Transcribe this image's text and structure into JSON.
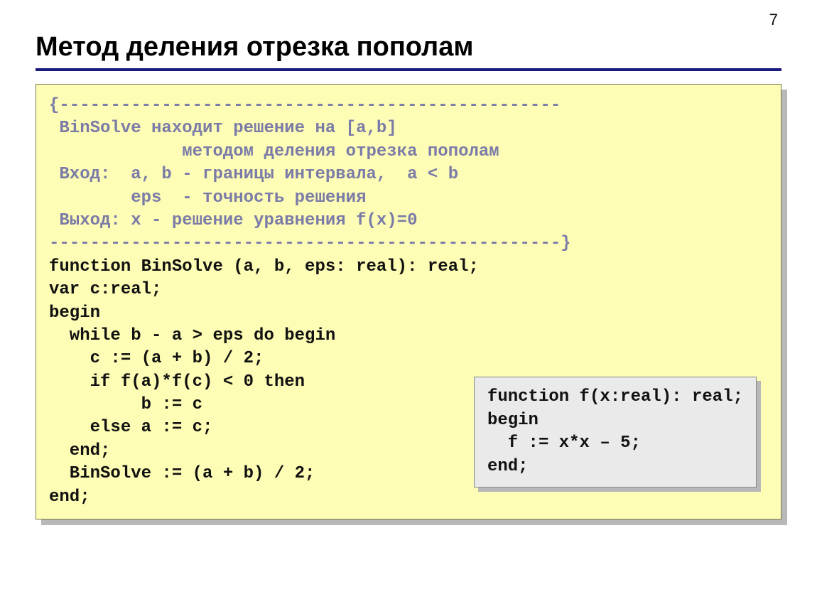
{
  "page_number": "7",
  "title": "Метод деления отрезка пополам",
  "code": {
    "c1": "{-------------------------------------------------",
    "c2": " BinSolve находит решение на [a,b]",
    "c3": "             методом деления отрезка пополам",
    "c4": " Вход:  a, b - границы интервала,  a < b",
    "c5": "        eps  - точность решения",
    "c6": " Выход: x - решение уравнения f(x)=0",
    "c7": "--------------------------------------------------}",
    "l1": "function BinSolve (a, b, eps: real): real;",
    "l2": "var c:real;",
    "l3": "begin",
    "l4": "  while b - a > eps do begin",
    "l5": "    c := (a + b) / 2;",
    "l6": "    if f(a)*f(c) < 0 then",
    "l7": "         b := c",
    "l8": "    else a := c;",
    "l9": "  end;",
    "l10": "  BinSolve := (a + b) / 2;",
    "l11": "end;"
  },
  "inset": {
    "l1": "function f(x:real): real;",
    "l2": "begin",
    "l3": "  f := x*x – 5;",
    "l4": "end;"
  }
}
